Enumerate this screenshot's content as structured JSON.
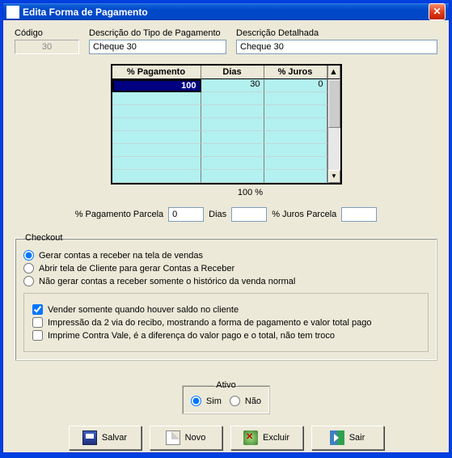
{
  "window": {
    "title": "Edita Forma de Pagamento"
  },
  "fields": {
    "codigo_label": "Código",
    "codigo_value": "30",
    "descricao_label": "Descrição do Tipo de Pagamento",
    "descricao_value": "Cheque 30",
    "detalhada_label": "Descrição Detalhada",
    "detalhada_value": "Cheque 30"
  },
  "grid": {
    "headers": {
      "pct": "% Pagamento",
      "dias": "Dias",
      "juros": "% Juros"
    },
    "rows": [
      {
        "pct": "100",
        "dias": "30",
        "juros": "0"
      }
    ],
    "total_label": "100 %"
  },
  "parcela": {
    "pct_label": "% Pagamento Parcela",
    "pct_value": "0",
    "dias_label": "Dias",
    "dias_value": "",
    "juros_label": "% Juros Parcela",
    "juros_value": ""
  },
  "checkout": {
    "legend": "Checkout",
    "opt1": "Gerar contas a receber na tela de vendas",
    "opt2": "Abrir tela de Cliente para gerar Contas a Receber",
    "opt3": "Não gerar contas a receber somente o histórico da venda normal",
    "chk1": "Vender somente quando houver saldo no cliente",
    "chk2": "Impressão da 2 via do recibo, mostrando a forma de pagamento e valor total pago",
    "chk3": "Imprime Contra Vale, é a diferença do valor pago e o total, não tem troco"
  },
  "ativo": {
    "legend": "Ativo",
    "sim": "Sim",
    "nao": "Não"
  },
  "buttons": {
    "salvar": "Salvar",
    "novo": "Novo",
    "excluir": "Excluir",
    "sair": "Sair"
  }
}
